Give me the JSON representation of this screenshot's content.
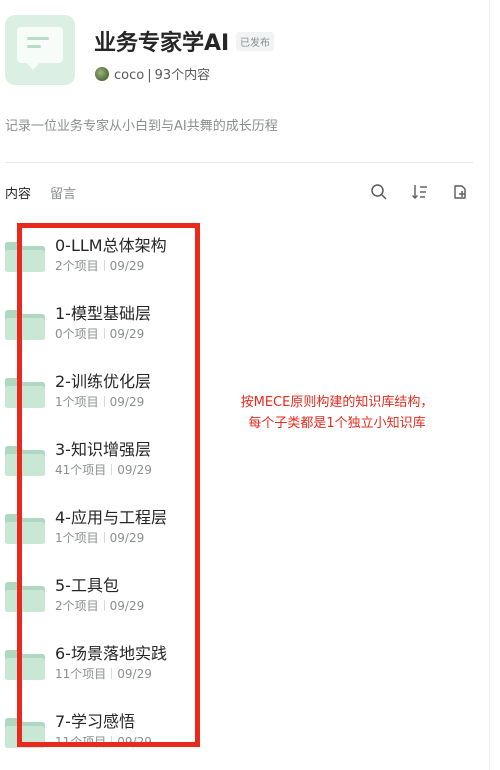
{
  "header": {
    "title": "业务专家学AI",
    "status_badge": "已发布",
    "author": "coco",
    "separator": "|",
    "content_count": "93个内容",
    "description": "记录一位业务专家从小白到与AI共舞的成长历程"
  },
  "tabs": [
    {
      "label": "内容",
      "active": true
    },
    {
      "label": "留言",
      "active": false
    }
  ],
  "toolbar": {
    "search_icon": "search-icon",
    "sort_icon": "sort-icon",
    "new_doc_icon": "new-document-icon"
  },
  "items": [
    {
      "name": "0-LLM总体架构",
      "count": "2个项目",
      "date": "09/29"
    },
    {
      "name": "1-模型基础层",
      "count": "0个项目",
      "date": "09/29"
    },
    {
      "name": "2-训练优化层",
      "count": "1个项目",
      "date": "09/29"
    },
    {
      "name": "3-知识增强层",
      "count": "41个项目",
      "date": "09/29"
    },
    {
      "name": "4-应用与工程层",
      "count": "1个项目",
      "date": "09/29"
    },
    {
      "name": "5-工具包",
      "count": "2个项目",
      "date": "09/29"
    },
    {
      "name": "6-场景落地实践",
      "count": "11个项目",
      "date": "09/29"
    },
    {
      "name": "7-学习感悟",
      "count": "11个项目",
      "date": "09/29"
    }
  ],
  "annotation": {
    "line1": "按MECE原则构建的知识库结构，",
    "line2": "每个子类都是1个独立小知识库",
    "color": "#e8291c"
  },
  "colors": {
    "folder": "#c9e7d5",
    "folder_dark": "#aed8bf",
    "text_primary": "#262626",
    "text_secondary": "#8a8f8d"
  }
}
